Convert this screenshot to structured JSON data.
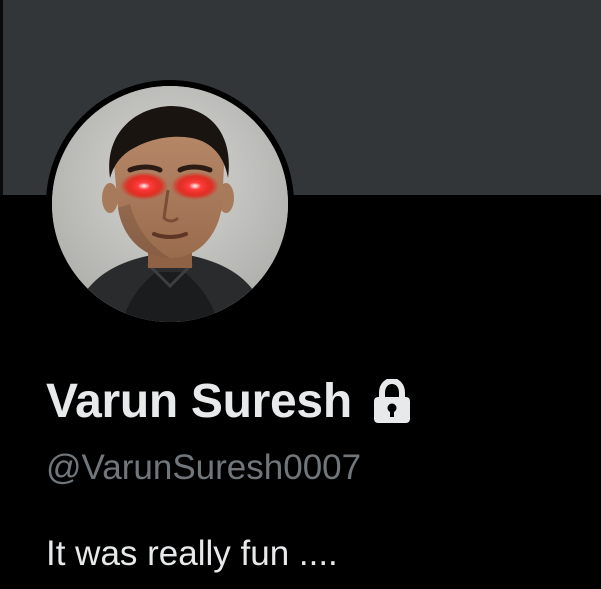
{
  "profile": {
    "display_name": "Varun Suresh",
    "handle": "@VarunSuresh0007",
    "bio": "It was really fun ....",
    "protected_icon": "lock-icon",
    "avatar_description_icon": "profile-photo"
  },
  "colors": {
    "background": "#000000",
    "banner": "#333639",
    "name_text": "#e7e9ea",
    "handle_text": "#71767b",
    "eye_glow": "#ff1a1a"
  }
}
